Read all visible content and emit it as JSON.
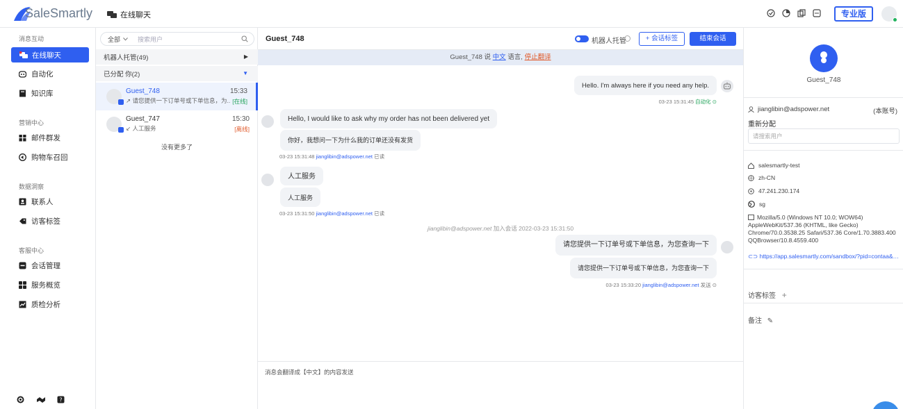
{
  "brand": {
    "name": "SaleSmartly",
    "pro_label": "专业版"
  },
  "header": {
    "title": "在线聊天"
  },
  "nav": {
    "sec_interact": "消息互动",
    "live_chat": "在线聊天",
    "automation": "自动化",
    "knowledge": "知识库",
    "sec_marketing": "营销中心",
    "email": "邮件群发",
    "cart": "购物车召回",
    "sec_data": "数据洞察",
    "contacts": "联系人",
    "visitor_tags": "访客标签",
    "sec_service": "客服中心",
    "session_mgmt": "会话管理",
    "service_overview": "服务概览",
    "quality": "质检分析"
  },
  "list": {
    "filter": "全部",
    "search_placeholder": "搜索用户",
    "group_bot": "机器人托管(49)",
    "group_assigned": "已分配  你(2)",
    "conversations": [
      {
        "name": "Guest_748",
        "time": "15:33",
        "message": "↗ 请您提供一下订单号或下单信息，为...",
        "status": "[在线]"
      },
      {
        "name": "Guest_747",
        "time": "15:30",
        "message": "↙ 人工服务",
        "status": "[离线]"
      }
    ],
    "no_more": "没有更多了"
  },
  "chat": {
    "title": "Guest_748",
    "bot_toggle_label": "机器人托管",
    "tag_button": "+ 会话标签",
    "end_button": "结束会话",
    "lang_prefix": "Guest_748 说 ",
    "lang_link": "中文",
    "lang_mid": " 语言, ",
    "lang_stop": "停止翻译",
    "messages": {
      "m1": "Hello. I'm always here if you need any help.",
      "m1_time": "03-23 15:31:45",
      "m1_status": "自动化 ⊙",
      "m2": "Hello, I would like to ask why my order has not been delivered yet",
      "m2_tr": "你好，我想问一下为什么我的订单还没有发货",
      "m2_time": "03-23 15:31:48",
      "m2_user": "jianglibin@adspower.net",
      "m2_read": "已读",
      "m3": "人工服务",
      "m3_tr": "人工服务",
      "m3_time": "03-23 15:31:50",
      "m3_user": "jianglibin@adspower.net",
      "m3_read": "已读",
      "sys_user": "jianglibin@adspower.net",
      "sys_text": " 加入会话 2022-03-23 15:31:50",
      "m4": "请您提供一下订单号或下单信息，为您查询一下",
      "m4_tr": "请您提供一下订单号或下单信息，为您查询一下",
      "m4_time": "03-23 15:33:20",
      "m4_user": "jianglibin@adspower.net",
      "m4_status": "发送 ⊙"
    },
    "composer_hint": "消息会翻译成【中文】的内容发送"
  },
  "profile": {
    "name": "Guest_748",
    "agent_email": "jianglibin@adspower.net",
    "agent_note": "(本账号)",
    "reassign_label": "重新分配",
    "search_placeholder": "请搜索用户",
    "project": "salesmartly-test",
    "language": "zh-CN",
    "ip": "47.241.230.174",
    "country": "sg",
    "user_agent": "Mozilla/5.0 (Windows NT 10.0; WOW64) AppleWebKit/537.36 (KHTML, like Gecko) Chrome/70.0.3538.25 Safari/537.36 Core/1.70.3883.400 QQBrowser/10.8.4559.400",
    "url": "https://app.salesmartly.com/sandbox/?pid=contaa&fid=...",
    "visitor_tags_label": "访客标签",
    "notes_label": "备注"
  },
  "colors": {
    "accent": "#2f5ff0",
    "online": "#22a35a",
    "offline": "#e05a2b"
  }
}
